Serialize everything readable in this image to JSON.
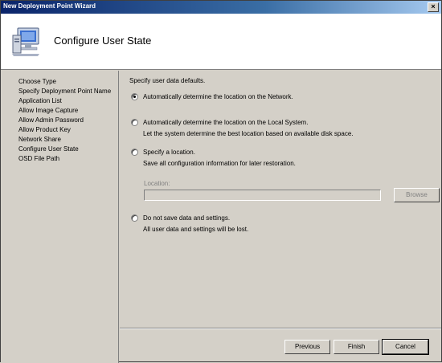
{
  "window": {
    "title": "New Deployment Point Wizard",
    "close_glyph": "×"
  },
  "header": {
    "title": "Configure User State",
    "icon": "computer-icon"
  },
  "nav": {
    "items": [
      {
        "label": "Choose Type"
      },
      {
        "label": "Specify Deployment Point Name"
      },
      {
        "label": "Application List"
      },
      {
        "label": "Allow Image Capture"
      },
      {
        "label": "Allow Admin Password"
      },
      {
        "label": "Allow Product Key"
      },
      {
        "label": "Network Share"
      },
      {
        "label": "Configure User State"
      },
      {
        "label": "OSD File Path"
      }
    ]
  },
  "main": {
    "intro": "Specify user data defaults.",
    "options": [
      {
        "label": "Automatically determine the location on the Network.",
        "description": "",
        "checked": true
      },
      {
        "label": "Automatically determine the location on the Local System.",
        "description": "Let the system determine the best location based on available disk space.",
        "checked": false
      },
      {
        "label": "Specify a location.",
        "description": "Save all configuration information for later restoration.",
        "checked": false
      },
      {
        "label": "Do not save data and settings.",
        "description": "All user data and settings will be lost.",
        "checked": false
      }
    ],
    "location_label": "Location:",
    "location_value": "",
    "browse_label": "Browse"
  },
  "footer": {
    "previous_label": "Previous",
    "finish_label": "Finish",
    "cancel_label": "Cancel"
  }
}
